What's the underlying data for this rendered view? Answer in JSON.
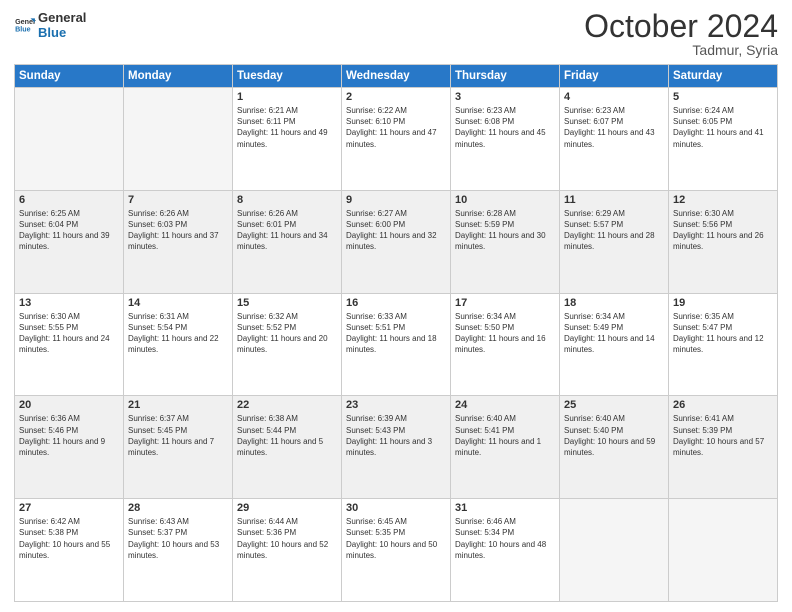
{
  "header": {
    "logo_line1": "General",
    "logo_line2": "Blue",
    "month": "October 2024",
    "location": "Tadmur, Syria"
  },
  "weekdays": [
    "Sunday",
    "Monday",
    "Tuesday",
    "Wednesday",
    "Thursday",
    "Friday",
    "Saturday"
  ],
  "weeks": [
    [
      {
        "day": "",
        "empty": true
      },
      {
        "day": "",
        "empty": true
      },
      {
        "day": "1",
        "sunrise": "6:21 AM",
        "sunset": "6:11 PM",
        "daylight": "11 hours and 49 minutes."
      },
      {
        "day": "2",
        "sunrise": "6:22 AM",
        "sunset": "6:10 PM",
        "daylight": "11 hours and 47 minutes."
      },
      {
        "day": "3",
        "sunrise": "6:23 AM",
        "sunset": "6:08 PM",
        "daylight": "11 hours and 45 minutes."
      },
      {
        "day": "4",
        "sunrise": "6:23 AM",
        "sunset": "6:07 PM",
        "daylight": "11 hours and 43 minutes."
      },
      {
        "day": "5",
        "sunrise": "6:24 AM",
        "sunset": "6:05 PM",
        "daylight": "11 hours and 41 minutes."
      }
    ],
    [
      {
        "day": "6",
        "sunrise": "6:25 AM",
        "sunset": "6:04 PM",
        "daylight": "11 hours and 39 minutes."
      },
      {
        "day": "7",
        "sunrise": "6:26 AM",
        "sunset": "6:03 PM",
        "daylight": "11 hours and 37 minutes."
      },
      {
        "day": "8",
        "sunrise": "6:26 AM",
        "sunset": "6:01 PM",
        "daylight": "11 hours and 34 minutes."
      },
      {
        "day": "9",
        "sunrise": "6:27 AM",
        "sunset": "6:00 PM",
        "daylight": "11 hours and 32 minutes."
      },
      {
        "day": "10",
        "sunrise": "6:28 AM",
        "sunset": "5:59 PM",
        "daylight": "11 hours and 30 minutes."
      },
      {
        "day": "11",
        "sunrise": "6:29 AM",
        "sunset": "5:57 PM",
        "daylight": "11 hours and 28 minutes."
      },
      {
        "day": "12",
        "sunrise": "6:30 AM",
        "sunset": "5:56 PM",
        "daylight": "11 hours and 26 minutes."
      }
    ],
    [
      {
        "day": "13",
        "sunrise": "6:30 AM",
        "sunset": "5:55 PM",
        "daylight": "11 hours and 24 minutes."
      },
      {
        "day": "14",
        "sunrise": "6:31 AM",
        "sunset": "5:54 PM",
        "daylight": "11 hours and 22 minutes."
      },
      {
        "day": "15",
        "sunrise": "6:32 AM",
        "sunset": "5:52 PM",
        "daylight": "11 hours and 20 minutes."
      },
      {
        "day": "16",
        "sunrise": "6:33 AM",
        "sunset": "5:51 PM",
        "daylight": "11 hours and 18 minutes."
      },
      {
        "day": "17",
        "sunrise": "6:34 AM",
        "sunset": "5:50 PM",
        "daylight": "11 hours and 16 minutes."
      },
      {
        "day": "18",
        "sunrise": "6:34 AM",
        "sunset": "5:49 PM",
        "daylight": "11 hours and 14 minutes."
      },
      {
        "day": "19",
        "sunrise": "6:35 AM",
        "sunset": "5:47 PM",
        "daylight": "11 hours and 12 minutes."
      }
    ],
    [
      {
        "day": "20",
        "sunrise": "6:36 AM",
        "sunset": "5:46 PM",
        "daylight": "11 hours and 9 minutes."
      },
      {
        "day": "21",
        "sunrise": "6:37 AM",
        "sunset": "5:45 PM",
        "daylight": "11 hours and 7 minutes."
      },
      {
        "day": "22",
        "sunrise": "6:38 AM",
        "sunset": "5:44 PM",
        "daylight": "11 hours and 5 minutes."
      },
      {
        "day": "23",
        "sunrise": "6:39 AM",
        "sunset": "5:43 PM",
        "daylight": "11 hours and 3 minutes."
      },
      {
        "day": "24",
        "sunrise": "6:40 AM",
        "sunset": "5:41 PM",
        "daylight": "11 hours and 1 minute."
      },
      {
        "day": "25",
        "sunrise": "6:40 AM",
        "sunset": "5:40 PM",
        "daylight": "10 hours and 59 minutes."
      },
      {
        "day": "26",
        "sunrise": "6:41 AM",
        "sunset": "5:39 PM",
        "daylight": "10 hours and 57 minutes."
      }
    ],
    [
      {
        "day": "27",
        "sunrise": "6:42 AM",
        "sunset": "5:38 PM",
        "daylight": "10 hours and 55 minutes."
      },
      {
        "day": "28",
        "sunrise": "6:43 AM",
        "sunset": "5:37 PM",
        "daylight": "10 hours and 53 minutes."
      },
      {
        "day": "29",
        "sunrise": "6:44 AM",
        "sunset": "5:36 PM",
        "daylight": "10 hours and 52 minutes."
      },
      {
        "day": "30",
        "sunrise": "6:45 AM",
        "sunset": "5:35 PM",
        "daylight": "10 hours and 50 minutes."
      },
      {
        "day": "31",
        "sunrise": "6:46 AM",
        "sunset": "5:34 PM",
        "daylight": "10 hours and 48 minutes."
      },
      {
        "day": "",
        "empty": true
      },
      {
        "day": "",
        "empty": true
      }
    ]
  ],
  "labels": {
    "sunrise": "Sunrise:",
    "sunset": "Sunset:",
    "daylight": "Daylight:"
  }
}
